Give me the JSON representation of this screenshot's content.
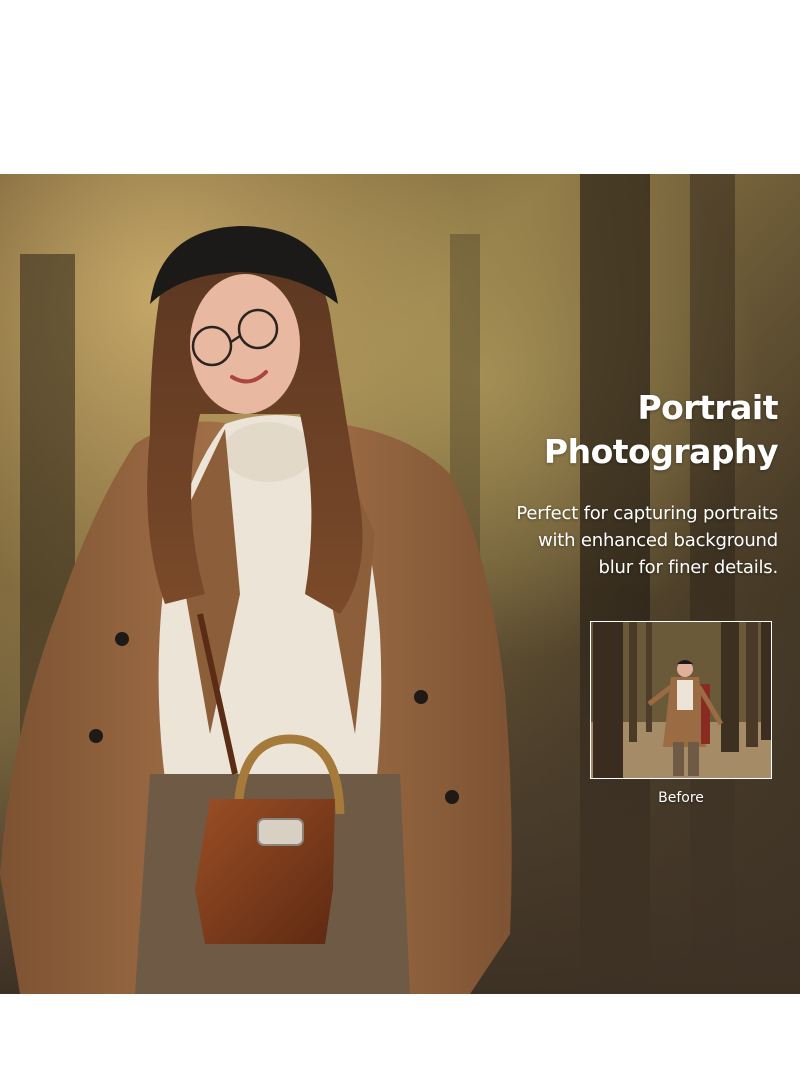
{
  "headline": {
    "line1": "Portrait",
    "line2": "Photography"
  },
  "description": {
    "line1": "Perfect for capturing portraits",
    "line2": "with enhanced background",
    "line3": "blur for finer details."
  },
  "before": {
    "label": "Before"
  },
  "colors": {
    "page_background": "#ffffff",
    "text": "#ffffff",
    "coat": "#9b6b43",
    "sweater": "#ece4d6",
    "beret": "#1c1a18",
    "bag": "#7a3b1e"
  },
  "icons": {
    "main_photo": "portrait-photo",
    "thumbnail": "before-photo"
  }
}
